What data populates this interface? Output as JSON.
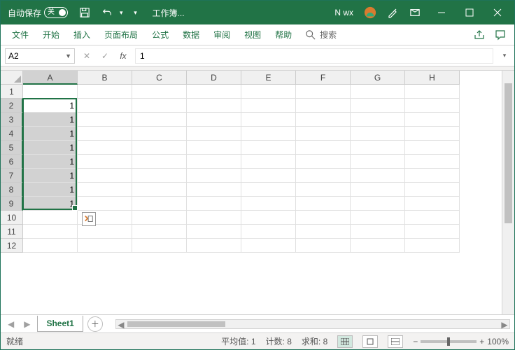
{
  "titlebar": {
    "autosave_label": "自动保存",
    "doc_title": "工作簿...",
    "account": "N wx"
  },
  "tabs": {
    "file": "文件",
    "home": "开始",
    "insert": "插入",
    "layout": "页面布局",
    "formula": "公式",
    "data": "数据",
    "review": "审阅",
    "view": "视图",
    "help": "帮助",
    "search": "搜索"
  },
  "namebox": {
    "ref": "A2"
  },
  "formula": {
    "value": "1"
  },
  "columns": [
    "A",
    "B",
    "C",
    "D",
    "E",
    "F",
    "G",
    "H"
  ],
  "rows": [
    "1",
    "2",
    "3",
    "4",
    "5",
    "6",
    "7",
    "8",
    "9",
    "10",
    "11",
    "12"
  ],
  "selection": {
    "col": 0,
    "rowStart": 1,
    "rowEnd": 8,
    "activeRow": 1
  },
  "cells": [
    {
      "r": 1,
      "c": 0,
      "v": "1"
    },
    {
      "r": 2,
      "c": 0,
      "v": "1"
    },
    {
      "r": 3,
      "c": 0,
      "v": "1"
    },
    {
      "r": 4,
      "c": 0,
      "v": "1"
    },
    {
      "r": 5,
      "c": 0,
      "v": "1"
    },
    {
      "r": 6,
      "c": 0,
      "v": "1"
    },
    {
      "r": 7,
      "c": 0,
      "v": "1"
    },
    {
      "r": 8,
      "c": 0,
      "v": "1"
    }
  ],
  "sheets": {
    "active": "Sheet1"
  },
  "status": {
    "ready": "就绪",
    "avg_label": "平均值:",
    "avg": "1",
    "count_label": "计数:",
    "count": "8",
    "sum_label": "求和:",
    "sum": "8",
    "zoom": "100%"
  }
}
